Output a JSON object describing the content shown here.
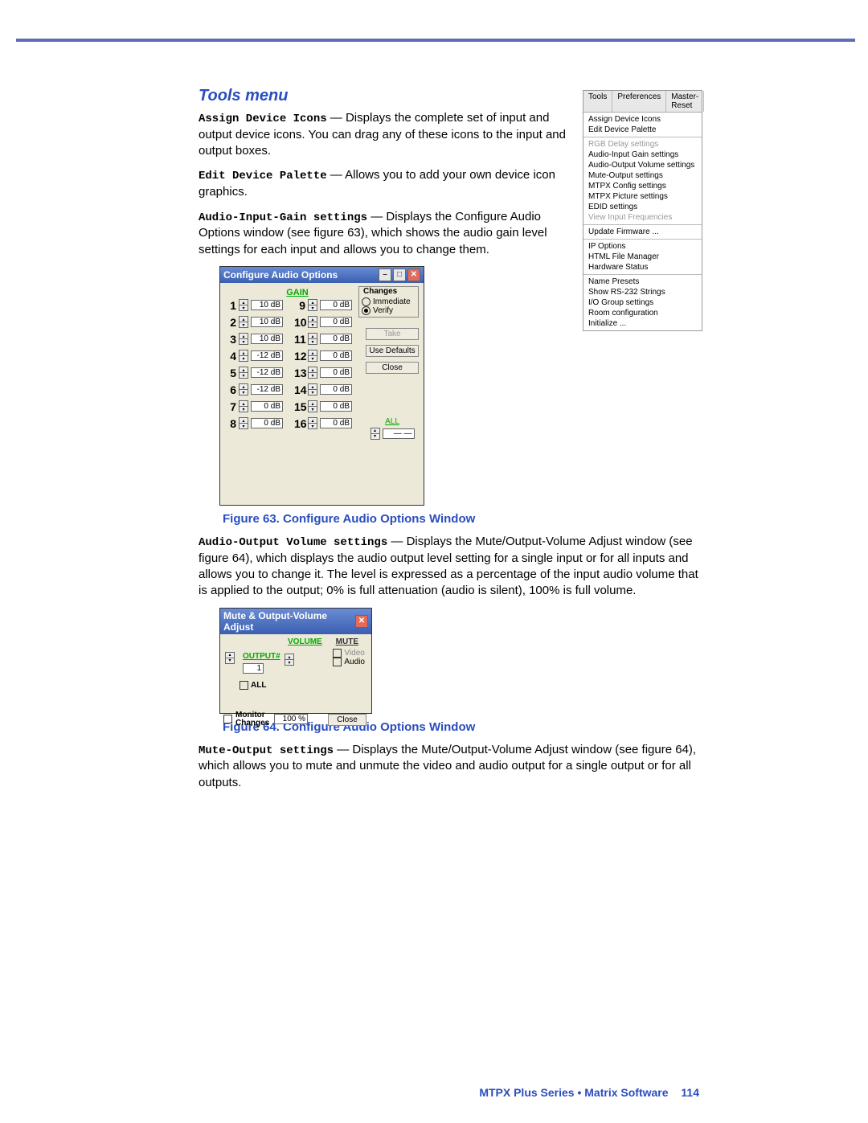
{
  "heading": "Tools menu",
  "defs": {
    "assign_lbl": "Assign Device Icons",
    "assign_txt": " — Displays the complete set of input and output device icons. You can drag any of these icons to the input and output boxes.",
    "edit_lbl": "Edit Device Palette",
    "edit_txt": " — Allows you to add your own device icon graphics.",
    "again_lbl": "Audio-Input-Gain settings",
    "again_txt": " — Displays the Configure Audio Options window (see figure 63), which shows the audio gain level settings for each input and allows you to change them.",
    "aov_lbl": "Audio-Output Volume settings",
    "aov_txt": " — Displays the Mute/Output-Volume Adjust window (see figure 64), which displays the audio output level setting for a single input or for all inputs and allows you to change it. The level is expressed as a percentage of the input audio volume that is applied to the output; 0% is full attenuation (audio is silent), 100% is full volume.",
    "mute_lbl": "Mute-Output settings",
    "mute_txt": " — Displays the Mute/Output-Volume Adjust window (see figure 64), which allows you to mute and unmute the video and audio output for a single output or for all outputs."
  },
  "fig63": "Figure 63.   Configure Audio Options Window",
  "fig64": "Figure 64.   Configure Audio Options Window",
  "tools_tabs": [
    "Tools",
    "Preferences",
    "Master-Reset"
  ],
  "tools_groups": [
    [
      "Assign Device Icons",
      "Edit Device Palette"
    ],
    [
      "RGB Delay settings",
      "Audio-Input Gain settings",
      "Audio-Output Volume settings",
      "Mute-Output settings",
      "MTPX Config settings",
      "MTPX Picture settings",
      "EDID settings",
      "View Input Frequencies"
    ],
    [
      "Update Firmware ..."
    ],
    [
      "IP Options",
      "HTML File Manager",
      "Hardware Status"
    ],
    [
      "Name Presets",
      "Show RS-232 Strings",
      "I/O Group settings",
      "Room configuration",
      "Initialize ..."
    ]
  ],
  "tools_disabled": [
    "RGB Delay settings",
    "View Input Frequencies"
  ],
  "audio_win": {
    "title": "Configure Audio Options",
    "gain_label": "GAIN",
    "changes_title": "Changes",
    "immediate": "Immediate",
    "verify": "Verify",
    "take": "Take",
    "use_defaults": "Use Defaults",
    "close": "Close",
    "all": "ALL",
    "all_val": "— —",
    "gains": [
      {
        "n": "1",
        "v": "10 dB",
        "n2": "9",
        "v2": "0 dB"
      },
      {
        "n": "2",
        "v": "10 dB",
        "n2": "10",
        "v2": "0 dB"
      },
      {
        "n": "3",
        "v": "10 dB",
        "n2": "11",
        "v2": "0 dB"
      },
      {
        "n": "4",
        "v": "-12 dB",
        "n2": "12",
        "v2": "0 dB"
      },
      {
        "n": "5",
        "v": "-12 dB",
        "n2": "13",
        "v2": "0 dB"
      },
      {
        "n": "6",
        "v": "-12 dB",
        "n2": "14",
        "v2": "0 dB"
      },
      {
        "n": "7",
        "v": "0 dB",
        "n2": "15",
        "v2": "0 dB"
      },
      {
        "n": "8",
        "v": "0 dB",
        "n2": "16",
        "v2": "0 dB"
      }
    ]
  },
  "mute_win": {
    "title": "Mute & Output-Volume Adjust",
    "volume": "VOLUME",
    "output": "OUTPUT#",
    "out_val": "1",
    "all": "ALL",
    "mute": "MUTE",
    "video": "Video",
    "audio": "Audio",
    "monitor": "Monitor Changes",
    "pct": "100 %",
    "close": "Close"
  },
  "footer": "MTPX Plus Series • Matrix Software",
  "page_num": "114"
}
